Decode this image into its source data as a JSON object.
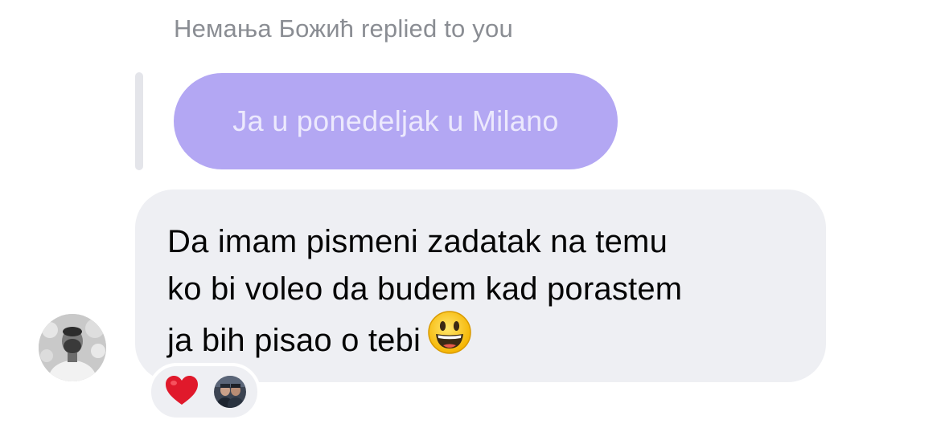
{
  "thread": {
    "reply_header": "Немања Божић replied to you",
    "quoted_message": "Ja u ponedeljak u Milano",
    "message": {
      "lines": [
        "Da imam pismeni zadatak na temu",
        "ko bi voleo da budem kad porastem",
        "ja bih pisao o tebi"
      ],
      "emoji": "smiling-face-icon"
    },
    "reactions": {
      "emoji": "red-heart-icon",
      "reactor": "reactor-avatar"
    }
  },
  "colors": {
    "quoted_bubble": "#b3a7f3",
    "message_bubble": "#eeeff3",
    "header_text": "#8a8d93",
    "heart": "#e0192b"
  }
}
